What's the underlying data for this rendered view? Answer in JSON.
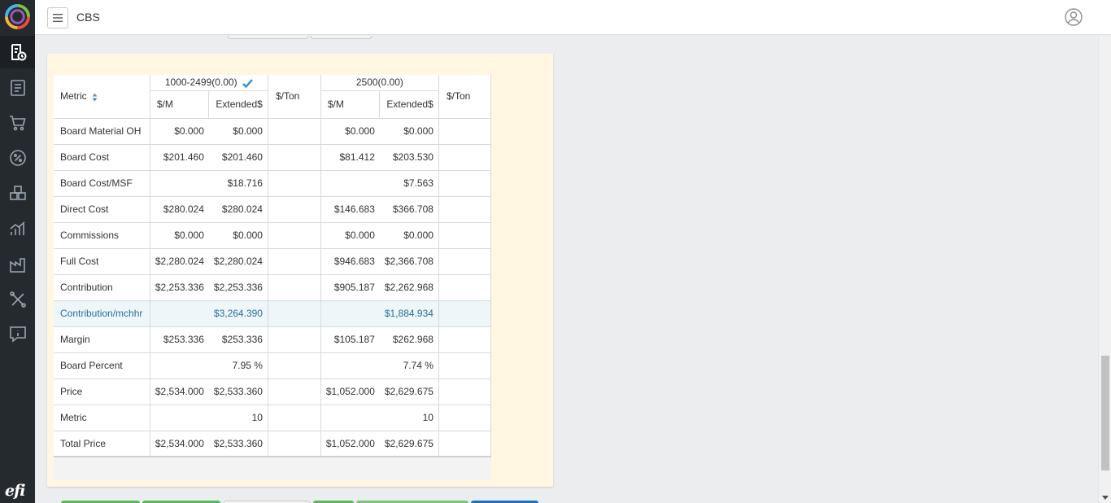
{
  "app": {
    "title": "CBS"
  },
  "sidebar": {
    "icons": [
      "quote-icon",
      "document-list-icon",
      "cart-icon",
      "percent-icon",
      "boxes-icon",
      "analytics-icon",
      "factory-icon",
      "tools-icon",
      "info-icon"
    ],
    "brand": "efi",
    "active_index": 0
  },
  "grid": {
    "headers": {
      "metric": "Metric",
      "group1": "1000-2499(0.00)",
      "group2": "2500(0.00)",
      "per_m": "$/M",
      "extended": "Extended$",
      "per_ton": "$/Ton"
    },
    "rows": [
      {
        "metric": "Board Material OH",
        "g1_m": "$0.000",
        "g1_ext": "$0.000",
        "g1_ton": "",
        "g2_m": "$0.000",
        "g2_ext": "$0.000",
        "g2_ton": ""
      },
      {
        "metric": "Board Cost",
        "g1_m": "$201.460",
        "g1_ext": "$201.460",
        "g1_ton": "",
        "g2_m": "$81.412",
        "g2_ext": "$203.530",
        "g2_ton": ""
      },
      {
        "metric": "Board Cost/MSF",
        "g1_m": "",
        "g1_ext": "$18.716",
        "g1_ton": "",
        "g2_m": "",
        "g2_ext": "$7.563",
        "g2_ton": ""
      },
      {
        "metric": "Direct Cost",
        "g1_m": "$280.024",
        "g1_ext": "$280.024",
        "g1_ton": "",
        "g2_m": "$146.683",
        "g2_ext": "$366.708",
        "g2_ton": ""
      },
      {
        "metric": "Commissions",
        "g1_m": "$0.000",
        "g1_ext": "$0.000",
        "g1_ton": "",
        "g2_m": "$0.000",
        "g2_ext": "$0.000",
        "g2_ton": ""
      },
      {
        "metric": "Full Cost",
        "g1_m": "$2,280.024",
        "g1_ext": "$2,280.024",
        "g1_ton": "",
        "g2_m": "$946.683",
        "g2_ext": "$2,366.708",
        "g2_ton": ""
      },
      {
        "metric": "Contribution",
        "g1_m": "$2,253.336",
        "g1_ext": "$2,253.336",
        "g1_ton": "",
        "g2_m": "$905.187",
        "g2_ext": "$2,262.968",
        "g2_ton": ""
      },
      {
        "metric": "Contribution/mchhr",
        "g1_m": "",
        "g1_ext": "$3,264.390",
        "g1_ton": "",
        "g2_m": "",
        "g2_ext": "$1,884.934",
        "g2_ton": "",
        "highlight": true
      },
      {
        "metric": "Margin",
        "g1_m": "$253.336",
        "g1_ext": "$253.336",
        "g1_ton": "",
        "g2_m": "$105.187",
        "g2_ext": "$262.968",
        "g2_ton": ""
      },
      {
        "metric": "Board Percent",
        "g1_m": "",
        "g1_ext": "7.95 %",
        "g1_ton": "",
        "g2_m": "",
        "g2_ext": "7.74 %",
        "g2_ton": ""
      },
      {
        "metric": "Price",
        "g1_m": "$2,534.000",
        "g1_ext": "$2,533.360",
        "g1_ton": "",
        "g2_m": "$1,052.000",
        "g2_ext": "$2,629.675",
        "g2_ton": ""
      },
      {
        "metric": "Metric",
        "g1_m": "",
        "g1_ext": "10",
        "g1_ton": "",
        "g2_m": "",
        "g2_ext": "10",
        "g2_ton": ""
      },
      {
        "metric": "Total Price",
        "g1_m": "$2,534.000",
        "g1_ext": "$2,533.360",
        "g1_ton": "",
        "g2_m": "$1,052.000",
        "g2_ext": "$2,629.675",
        "g2_ton": ""
      }
    ]
  },
  "colors": {
    "sidebar_bg": "#252a2f",
    "panel_bg": "#fff7e2",
    "highlight_text": "#2a6f99",
    "button_green": "#5cb85c",
    "button_blue": "#1f6fbf",
    "check_blue": "#2a8fd6"
  }
}
